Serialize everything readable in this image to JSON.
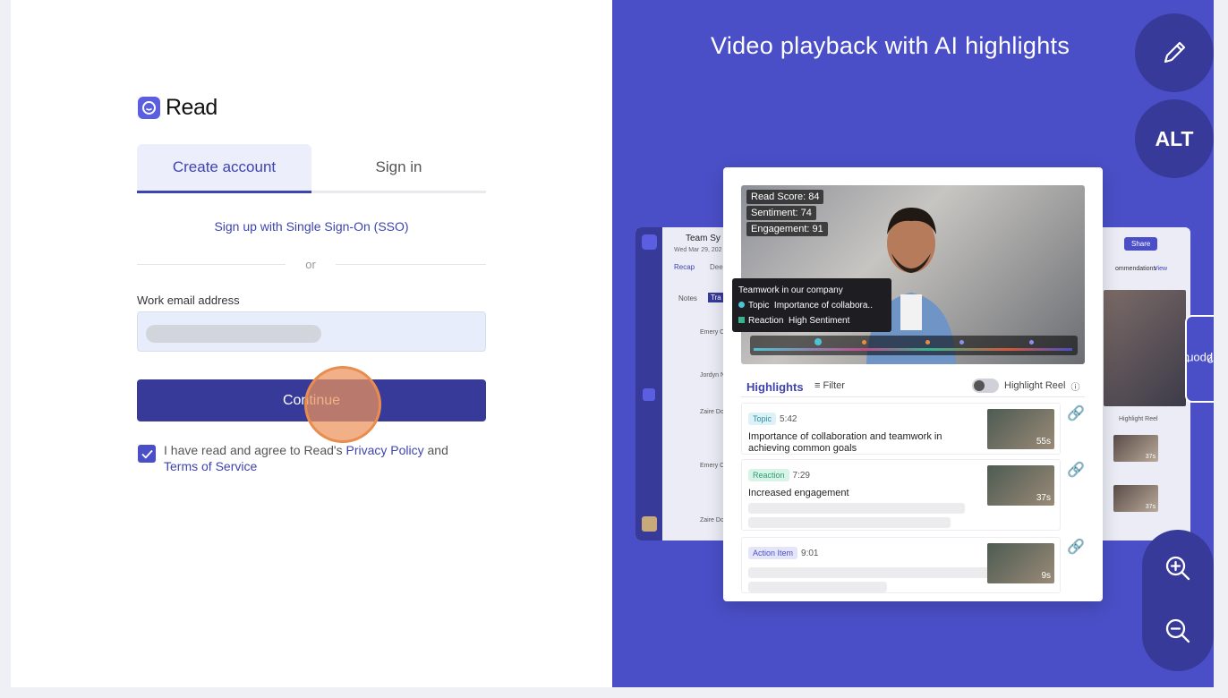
{
  "brand": {
    "name": "Read",
    "accent": "#3e44ae"
  },
  "tabs": {
    "create": "Create account",
    "signin": "Sign in"
  },
  "sso_link": "Sign up with Single Sign-On (SSO)",
  "or_text": "or",
  "email": {
    "label": "Work email address",
    "value": "",
    "placeholder": ""
  },
  "continue_label": "Continue",
  "agree": {
    "prefix": "I have read and agree to Read's",
    "privacy": "Privacy Policy",
    "and": "and",
    "terms": "Terms of Service",
    "checked": true
  },
  "promo": {
    "headline": "Video playback with AI highlights"
  },
  "side_buttons": {
    "edit_icon": "pencil-icon",
    "alt_label": "ALT",
    "zoom_in_icon": "zoom-in-icon",
    "zoom_out_icon": "zoom-out-icon"
  },
  "support_label": "Support",
  "preview": {
    "back_title": "Team Sy",
    "back_date": "Wed Mar 29, 202",
    "back_tabs": [
      "Recap",
      "Deep"
    ],
    "back_subtabs": [
      "Notes",
      "Tra"
    ],
    "back_names": [
      "Emery C",
      "Jordyn N",
      "Zaire Do",
      "Emery C",
      "Zaire Do"
    ],
    "share_label": "Share",
    "recommendations": "ommendations",
    "view_label": "View",
    "highlight_reel_small": "Highlight Reel",
    "stats": {
      "read_score": "Read Score: 84",
      "sentiment": "Sentiment: 74",
      "engagement": "Engagement: 91"
    },
    "tooltip": {
      "title": "Teamwork in our company",
      "topic_label": "Topic",
      "topic_value": "Importance of collabora..",
      "reaction_label": "Reaction",
      "reaction_value": "High Sentiment"
    },
    "highlights_title": "Highlights",
    "filter_label": "Filter",
    "reel_label": "Highlight Reel",
    "items": [
      {
        "tag": "Topic",
        "time": "5:42",
        "text": "Importance of collaboration and teamwork in achieving common goals",
        "duration": "55s"
      },
      {
        "tag": "Reaction",
        "time": "7:29",
        "text": "Increased engagement",
        "duration": "37s"
      },
      {
        "tag": "Action Item",
        "time": "9:01",
        "text": "",
        "duration": "9s"
      }
    ],
    "small_durations": [
      "37s",
      "37s"
    ]
  }
}
